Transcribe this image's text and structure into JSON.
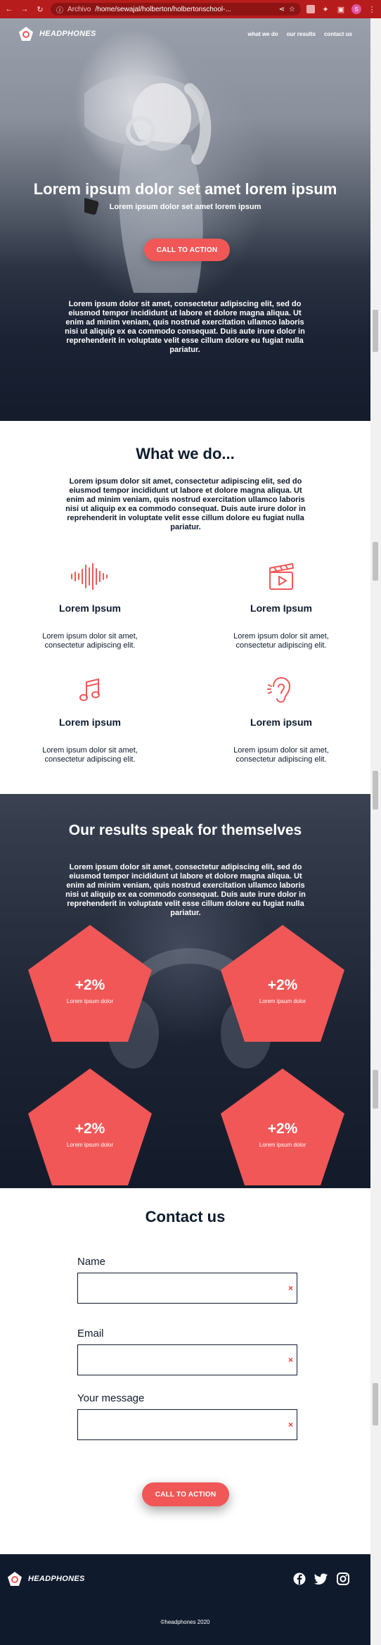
{
  "browser": {
    "tab_label": "Archivo",
    "url": "/home/sewajal/holberton/holbertonschool-..."
  },
  "nav": {
    "logo_text": "HEADPHONES",
    "links": [
      "what we do",
      "our results",
      "contact us"
    ]
  },
  "hero": {
    "title": "Lorem ipsum dolor set amet lorem ipsum",
    "subtitle": "Lorem ipsum dolor set amet lorem ipsum",
    "cta_label": "CALL TO ACTION",
    "body": "Lorem ipsum dolor sit amet, consectetur adipiscing elit, sed do eiusmod tempor incididunt ut labore et dolore magna aliqua. Ut enim ad minim veniam, quis nostrud exercitation ullamco laboris nisi ut aliquip ex ea commodo consequat. Duis aute irure dolor in reprehenderit in voluptate velit esse cillum dolore eu fugiat nulla pariatur."
  },
  "what_we_do": {
    "title": "What we do...",
    "body": "Lorem ipsum dolor sit amet, consectetur adipiscing elit, sed do eiusmod tempor incididunt ut labore et dolore magna aliqua. Ut enim ad minim veniam, quis nostrud exercitation ullamco laboris nisi ut aliquip ex ea commodo consequat. Duis aute irure dolor in reprehenderit in voluptate velit esse cillum dolore eu fugiat nulla pariatur.",
    "features": [
      {
        "icon": "soundwave-icon",
        "title": "Lorem Ipsum",
        "text": "Lorem ipsum dolor sit amet, consectetur adipiscing elit."
      },
      {
        "icon": "clapperboard-icon",
        "title": "Lorem Ipsum",
        "text": "Lorem ipsum dolor sit amet, consectetur adipiscing elit."
      },
      {
        "icon": "music-note-icon",
        "title": "Lorem ipsum",
        "text": "Lorem ipsum dolor sit amet, consectetur adipiscing elit."
      },
      {
        "icon": "ear-icon",
        "title": "Lorem ipsum",
        "text": "Lorem ipsum dolor sit amet, consectetur adipiscing elit."
      }
    ]
  },
  "results": {
    "title": "Our results speak for themselves",
    "body": "Lorem ipsum dolor sit amet, consectetur adipiscing elit, sed do eiusmod tempor incididunt ut labore et dolore magna aliqua. Ut enim ad minim veniam, quis nostrud exercitation ullamco laboris nisi ut aliquip ex ea commodo consequat. Duis aute irure dolor in reprehenderit in voluptate velit esse cillum dolore eu fugiat nulla pariatur.",
    "stats": [
      {
        "value": "+2%",
        "label": "Lorem ipsum dolor"
      },
      {
        "value": "+2%",
        "label": "Lorem ipsum dolor"
      },
      {
        "value": "+2%",
        "label": "Lorem ipsum dolor"
      },
      {
        "value": "+2%",
        "label": "Lorem ipsum dolor"
      }
    ]
  },
  "contact": {
    "title": "Contact us",
    "name_label": "Name",
    "email_label": "Email",
    "message_label": "Your message",
    "required_mark": "×",
    "cta_label": "CALL TO ACTION"
  },
  "footer": {
    "logo_text": "HEADPHONES",
    "copyright": "©headphones 2020",
    "social": [
      "facebook-icon",
      "twitter-icon",
      "instagram-icon"
    ]
  },
  "colors": {
    "accent": "#f25757",
    "dark": "#0f1b2d",
    "chrome": "#b71c1c"
  }
}
